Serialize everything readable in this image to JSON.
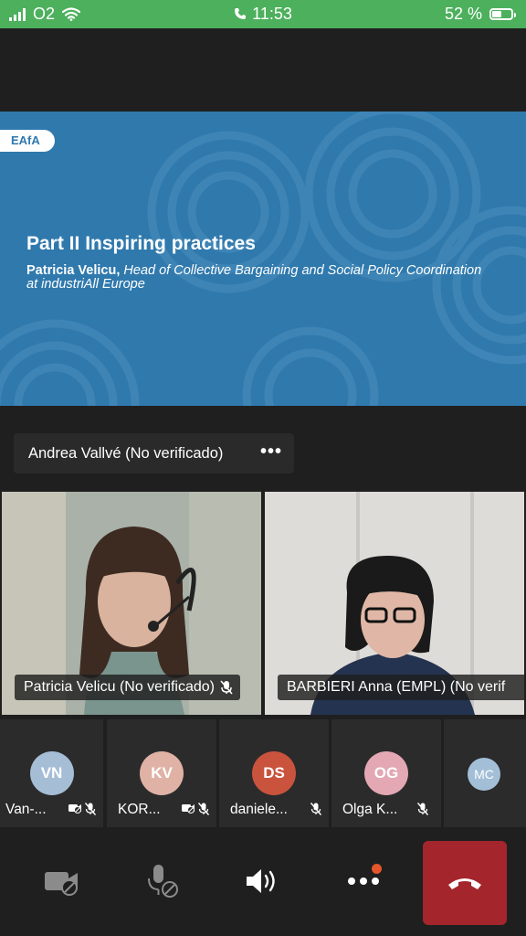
{
  "status_bar": {
    "carrier": "O2",
    "time": "11:53",
    "battery_percent": "52 %",
    "battery_level": 0.52
  },
  "slide": {
    "logo": "EAfA",
    "title": "Part II Inspiring practices",
    "subtitle_name": "Patricia Velicu,",
    "subtitle_role": " Head of Collective Bargaining and Social Policy Coordination at industriAll Europe"
  },
  "active_speaker": {
    "name": "Andrea Vallvé (No verificado)",
    "more_label": "•••"
  },
  "videos": [
    {
      "label": "Patricia Velicu (No verificado)"
    },
    {
      "label": "BARBIERI Anna (EMPL) (No verif"
    }
  ],
  "participants": [
    {
      "initials": "VN",
      "name": "Van-...",
      "color": "#a6bdd6"
    },
    {
      "initials": "KV",
      "name": "KOR...",
      "color": "#dfb2a5"
    },
    {
      "initials": "DS",
      "name": "daniele...",
      "color": "#c9533d"
    },
    {
      "initials": "OG",
      "name": "Olga K...",
      "color": "#e3a8b4"
    },
    {
      "initials": "MC",
      "name": "",
      "color": "#a3bfd8"
    }
  ],
  "toolbar": {
    "camera": "camera-off",
    "microphone": "microphone-off",
    "speaker": "speaker-on",
    "more": "more-actions",
    "end_call": "end-call",
    "colors": {
      "end_call": "#a4262c",
      "notification": "#e5572a"
    }
  }
}
